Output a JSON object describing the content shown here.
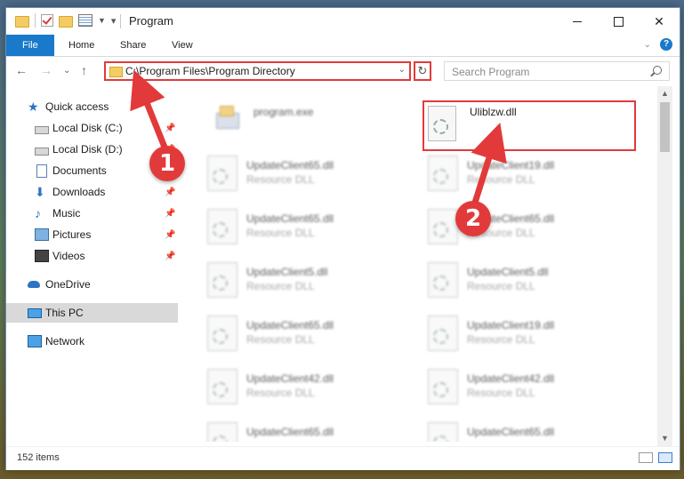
{
  "window": {
    "title": "Program"
  },
  "ribbon": {
    "tabs": [
      "File",
      "Home",
      "Share",
      "View"
    ],
    "help_label": "?"
  },
  "address": {
    "path": "C:\\Program Files\\Program Directory"
  },
  "search": {
    "placeholder": "Search Program"
  },
  "sidebar": {
    "quick_access": "Quick access",
    "items": [
      {
        "label": "Local Disk (C:)",
        "icon": "drive-icon",
        "pinned": true
      },
      {
        "label": "Local Disk (D:)",
        "icon": "drive-icon",
        "pinned": true
      },
      {
        "label": "Documents",
        "icon": "documents-icon",
        "pinned": true
      },
      {
        "label": "Downloads",
        "icon": "downloads-icon",
        "pinned": true
      },
      {
        "label": "Music",
        "icon": "music-icon",
        "pinned": true
      },
      {
        "label": "Pictures",
        "icon": "pictures-icon",
        "pinned": true
      },
      {
        "label": "Videos",
        "icon": "videos-icon",
        "pinned": true
      }
    ],
    "onedrive": "OneDrive",
    "this_pc": "This PC",
    "network": "Network"
  },
  "files": {
    "program": {
      "name": "program.exe"
    },
    "target": {
      "name": "Uliblzw.dll"
    },
    "type_label": "Resource DLL",
    "grid": [
      [
        "UpdateClient65.dll",
        "UpdateClient19.dll"
      ],
      [
        "UpdateClient65.dll",
        "UpdateClient65.dll"
      ],
      [
        "UpdateClient5.dll",
        "UpdateClient5.dll"
      ],
      [
        "UpdateClient65.dll",
        "UpdateClient19.dll"
      ],
      [
        "UpdateClient42.dll",
        "UpdateClient42.dll"
      ],
      [
        "UpdateClient65.dll",
        "UpdateClient65.dll"
      ]
    ]
  },
  "status": {
    "count": "152 items"
  },
  "annotations": {
    "step1": "1",
    "step2": "2"
  },
  "colors": {
    "accent": "#1979ca",
    "highlight": "#e23a3a"
  }
}
